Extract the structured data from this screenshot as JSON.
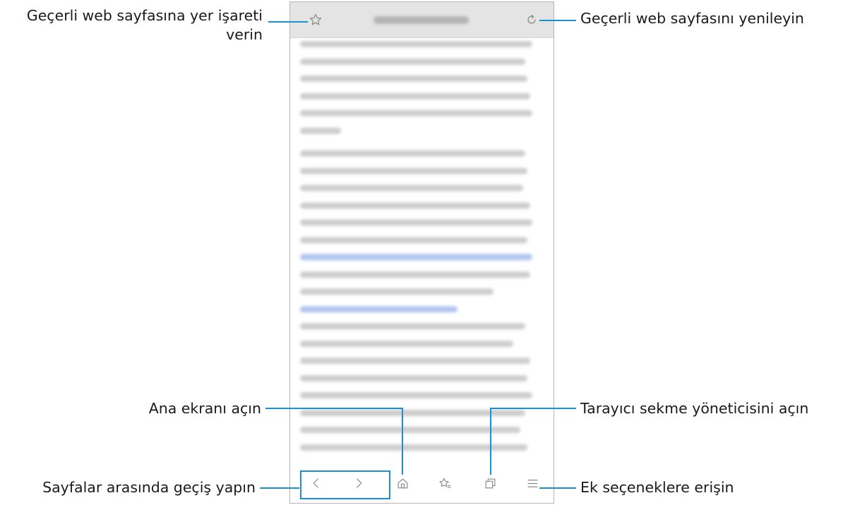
{
  "browser": {
    "url_text": "",
    "page_text_lines": 24
  },
  "labels": {
    "bookmark": "Geçerli web sayfasına yer işareti verin",
    "bookmark_line1": "Geçerli web sayfasına yer işareti",
    "bookmark_line2": "verin",
    "refresh": "Geçerli web sayfasını yenileyin",
    "home": "Ana ekranı açın",
    "tabs": "Tarayıcı sekme yöneticisini açın",
    "navigate": "Sayfalar arasında geçiş yapın",
    "more": "Ek seçeneklere erişin"
  },
  "icons": {
    "bookmark": "star-outline-icon",
    "refresh": "refresh-icon",
    "back": "chevron-left-icon",
    "forward": "chevron-right-icon",
    "home": "home-icon",
    "bookmarks": "bookmarks-icon",
    "tabs": "tabs-icon",
    "menu": "menu-icon"
  },
  "colors": {
    "leader": "#1a8fd1",
    "topbar": "#e4e4e4",
    "icon": "#8a8a8a",
    "link": "#3c6fd6"
  }
}
